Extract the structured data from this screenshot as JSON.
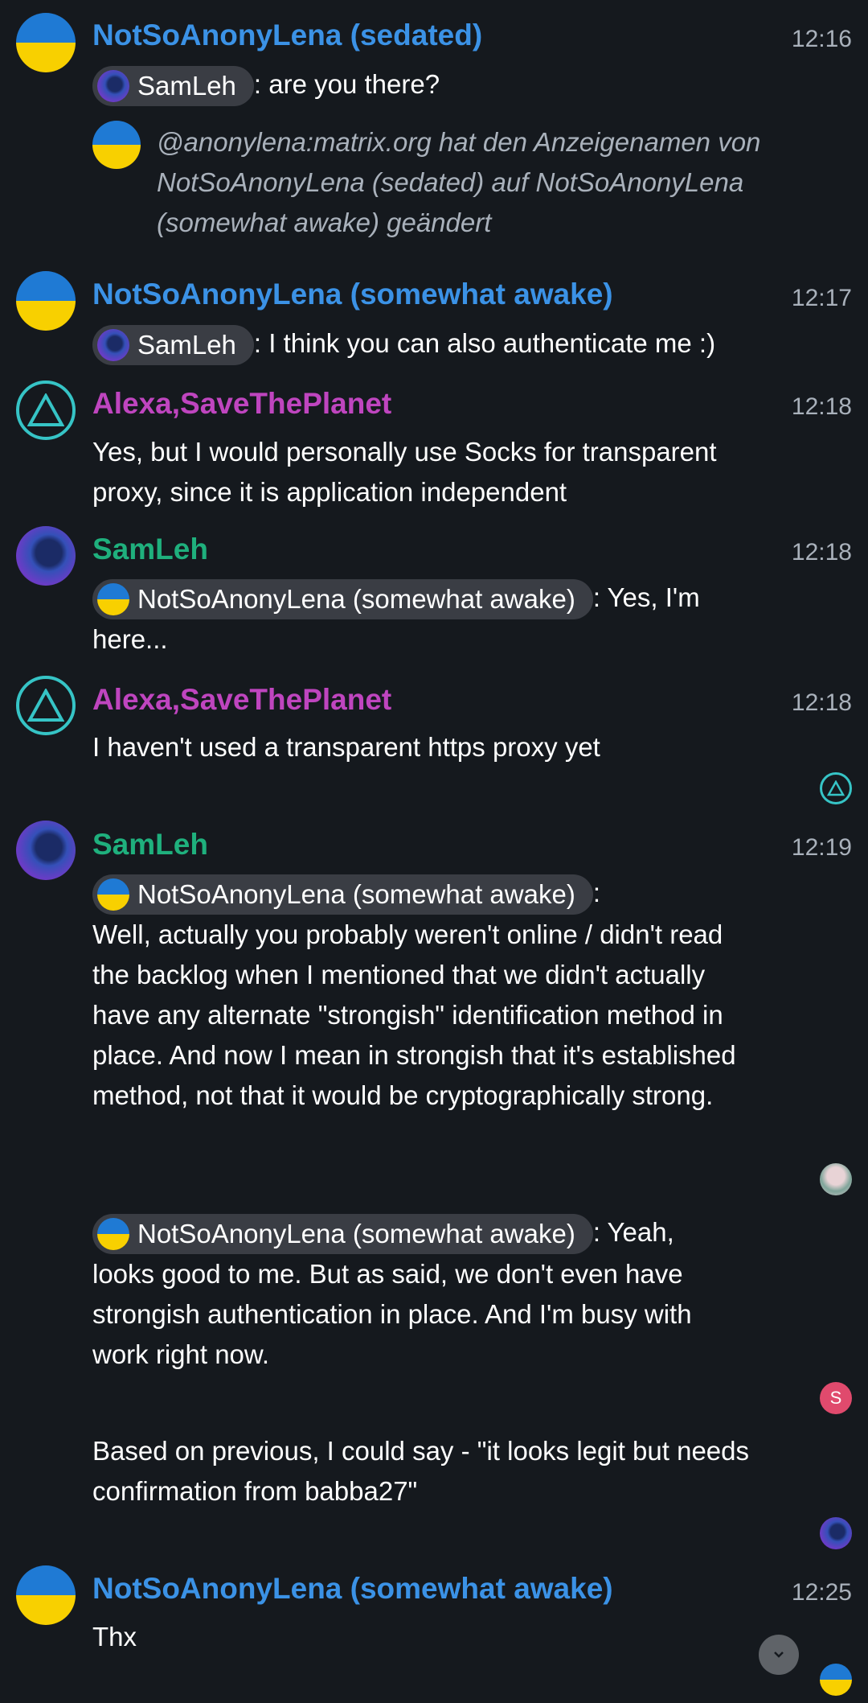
{
  "messages": [
    {
      "sender": "NotSoAnonyLena (sedated)",
      "time": "12:16",
      "mention": "SamLeh",
      "text": ": are you there?"
    },
    {
      "notice": "@anonylena:matrix.org hat den Anzeigenamen von NotSoAnonyLena (sedated) auf NotSoAnonyLena (somewhat awake) geändert"
    },
    {
      "sender": "NotSoAnonyLena (somewhat awake)",
      "time": "12:17",
      "mention": "SamLeh",
      "text": ": I think you can also authenticate me :)"
    },
    {
      "sender": "Alexa,SaveThePlanet",
      "time": "12:18",
      "text": "Yes, but I would personally use Socks for transparent proxy, since it is application independent"
    },
    {
      "sender": "SamLeh",
      "time": "12:18",
      "mention": "NotSoAnonyLena (somewhat awake)",
      "text_a": ": Yes, I'm",
      "text_b": "here..."
    },
    {
      "sender": "Alexa,SaveThePlanet",
      "time": "12:18",
      "text": "I haven't used a transparent https proxy yet"
    },
    {
      "sender": "SamLeh",
      "time": "12:19",
      "mention": "NotSoAnonyLena (somewhat awake)",
      "text": ":",
      "body": "Well, actually you probably weren't online / didn't read the backlog when I mentioned that we didn't actually have any alternate \"strongish\" identification method in place. And now I mean in strongish that it's established method, not that it would be cryptographically strong."
    },
    {
      "mention": "NotSoAnonyLena (somewhat awake)",
      "text_a": ": Yeah,",
      "text_b": "looks good to me. But as said, we don't even have strongish authentication in place. And I'm busy with work right now."
    },
    {
      "text": "Based on previous, I could say - \"it looks legit but needs confirmation from babba27\""
    },
    {
      "sender": "NotSoAnonyLena (somewhat awake)",
      "time": "12:25",
      "text": "Thx"
    }
  ],
  "receipts": {
    "s_initial": "S"
  },
  "colors": {
    "background": "#15191e",
    "lena": "#3b92e6",
    "alexa": "#bf45bf",
    "samleh": "#1fb07d",
    "pill": "#3a3d44"
  }
}
